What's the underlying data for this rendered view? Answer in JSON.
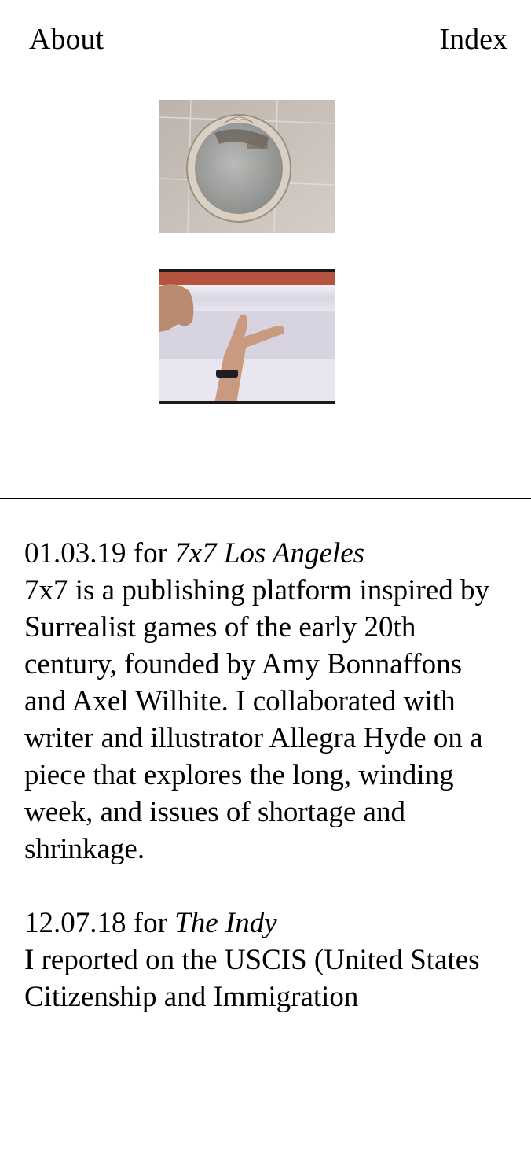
{
  "nav": {
    "about_label": "About",
    "index_label": "Index"
  },
  "gallery": {
    "images": [
      {
        "name": "round-mirror-photo",
        "alt": "Ornate round mirror on a tiled wall"
      },
      {
        "name": "hands-on-paper-roll-photo",
        "alt": "Hands pressing on a white paper roll"
      }
    ]
  },
  "entries": [
    {
      "date": "01.03.19",
      "for_text": " for ",
      "publication": "7x7 Los Angeles",
      "body": "7x7 is a publishing platform inspired by Surrealist games of the early 20th century, founded by Amy Bonnaffons and Axel Wilhite. I collaborated with writer and illustrator Allegra Hyde on a piece that explores the long, winding week, and issues of shortage and shrinkage."
    },
    {
      "date": "12.07.18",
      "for_text": " for ",
      "publication": "The Indy",
      "body": "I reported on the USCIS (United States Citizenship and Immigration"
    }
  ],
  "colors": {
    "text": "#000000",
    "background": "#ffffff"
  }
}
